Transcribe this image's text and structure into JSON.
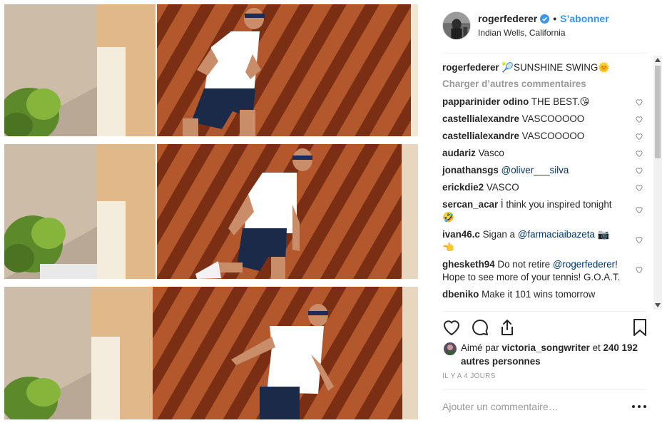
{
  "post": {
    "author": "rogerfederer",
    "follow_label": "S’abonner",
    "location": "Indian Wells, California",
    "caption_user": "rogerfederer",
    "caption_text": "🎾SUNSHINE SWING🌞",
    "load_more": "Charger d’autres commentaires",
    "comments": [
      {
        "user": "papparinider odino",
        "text": "THE BEST.😘"
      },
      {
        "user": "castellialexandre",
        "text": "VASCOOOOO"
      },
      {
        "user": "castellialexandre",
        "text": "VASCOOOOO"
      },
      {
        "user": "audariz",
        "text": "Vasco"
      },
      {
        "user": "jonathansgs",
        "text": "",
        "mention": "@oliver___silva"
      },
      {
        "user": "erickdie2",
        "text": "VASCO"
      },
      {
        "user": "sercan_acar",
        "text": "İ think you inspired tonight🤣"
      },
      {
        "user": "ivan46.c",
        "text": "Sigan a",
        "mention": "@farmaciaibazeta",
        "after": "📷 👈"
      },
      {
        "user": "ghesketh94",
        "text": "Do not retire",
        "mention": "@rogerfederer",
        "after": "! Hope to see more of your tennis! G.O.A.T."
      },
      {
        "user": "dbeniko",
        "text": "Make it 101 wins tomorrow"
      }
    ],
    "liked_by_prefix": "Aimé par",
    "liked_by_user": "victoria_songwriter",
    "liked_by_suffix": "et",
    "liked_by_count": "240 192 autres personnes",
    "timestamp": "IL Y A 4 JOURS",
    "add_comment_placeholder": "Ajouter un commentaire…",
    "icons": {
      "verified": "verified-badge-icon",
      "like": "heart-icon",
      "comment": "comment-icon",
      "share": "share-icon",
      "save": "bookmark-icon",
      "more": "more-options-icon"
    },
    "colors": {
      "link": "#3897f0",
      "mention": "#003569",
      "muted": "#999999",
      "wall": "#a8502a",
      "shirt": "#ffffff",
      "shorts": "#1c2a4a"
    }
  }
}
